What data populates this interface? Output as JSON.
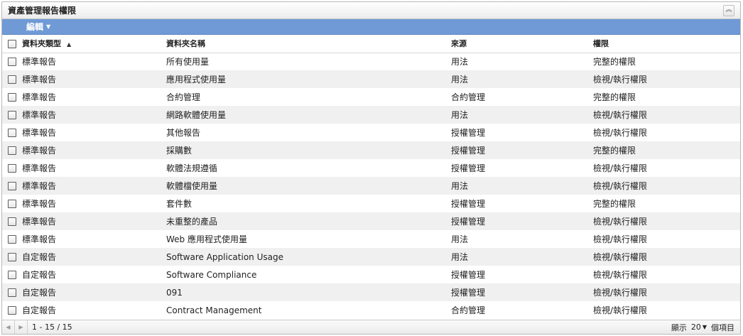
{
  "panel": {
    "title": "資產管理報告權限",
    "collapse_icon": "double-chevron-up-icon"
  },
  "toolbar": {
    "edit_label": "編輯",
    "edit_caret": "▼"
  },
  "table": {
    "headers": {
      "type": "資料夾類型",
      "sort_indicator": "▲",
      "name": "資料夾名稱",
      "source": "來源",
      "permission": "權限"
    },
    "rows": [
      {
        "type": "標準報告",
        "name": "所有使用量",
        "source": "用法",
        "permission": "完整的權限"
      },
      {
        "type": "標準報告",
        "name": "應用程式使用量",
        "source": "用法",
        "permission": "檢視/執行權限"
      },
      {
        "type": "標準報告",
        "name": "合約管理",
        "source": "合約管理",
        "permission": "完整的權限"
      },
      {
        "type": "標準報告",
        "name": "網路軟體使用量",
        "source": "用法",
        "permission": "檢視/執行權限"
      },
      {
        "type": "標準報告",
        "name": "其他報告",
        "source": "授權管理",
        "permission": "檢視/執行權限"
      },
      {
        "type": "標準報告",
        "name": "採購數",
        "source": "授權管理",
        "permission": "完整的權限"
      },
      {
        "type": "標準報告",
        "name": "軟體法規遵循",
        "source": "授權管理",
        "permission": "檢視/執行權限"
      },
      {
        "type": "標準報告",
        "name": "軟體檔使用量",
        "source": "用法",
        "permission": "檢視/執行權限"
      },
      {
        "type": "標準報告",
        "name": "套件數",
        "source": "授權管理",
        "permission": "完整的權限"
      },
      {
        "type": "標準報告",
        "name": "未重整的產品",
        "source": "授權管理",
        "permission": "檢視/執行權限"
      },
      {
        "type": "標準報告",
        "name": "Web 應用程式使用量",
        "source": "用法",
        "permission": "檢視/執行權限"
      },
      {
        "type": "自定報告",
        "name": "Software Application Usage",
        "source": "用法",
        "permission": "檢視/執行權限"
      },
      {
        "type": "自定報告",
        "name": "Software Compliance",
        "source": "授權管理",
        "permission": "檢視/執行權限"
      },
      {
        "type": "自定報告",
        "name": "091",
        "source": "授權管理",
        "permission": "檢視/執行權限"
      },
      {
        "type": "自定報告",
        "name": "Contract Management",
        "source": "合約管理",
        "permission": "檢視/執行權限"
      }
    ]
  },
  "footer": {
    "range": "1 - 15 / 15",
    "show_label": "顯示",
    "page_size": "20",
    "items_label": "個項目"
  }
}
